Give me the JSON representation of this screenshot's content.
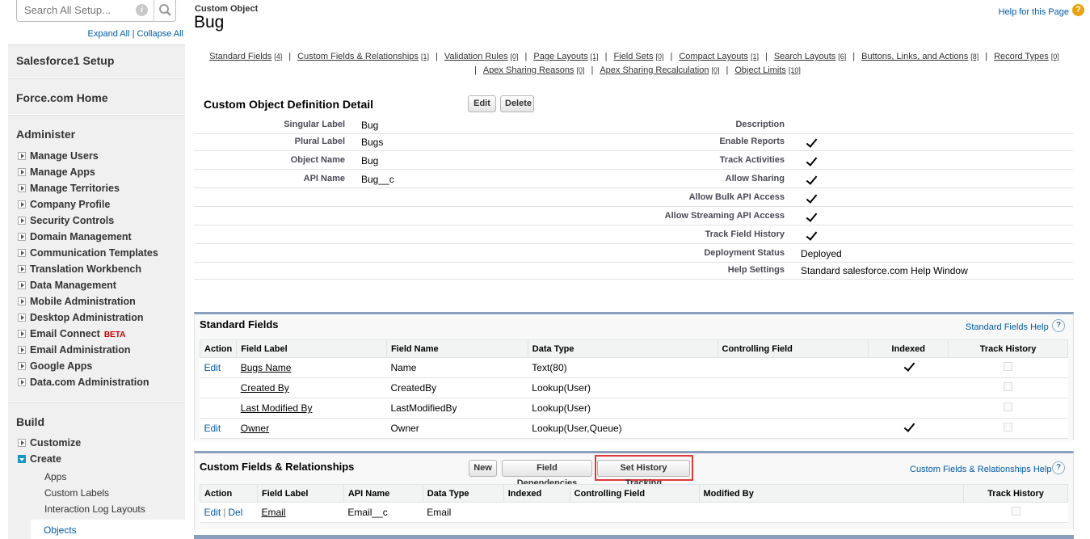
{
  "search": {
    "placeholder": "Search All Setup..."
  },
  "sidebar": {
    "expand_all": "Expand All",
    "separator": "|",
    "collapse_all": "Collapse All",
    "salesforce1_setup": "Salesforce1 Setup",
    "force_home": "Force.com Home",
    "administer": {
      "heading": "Administer",
      "items": [
        "Manage Users",
        "Manage Apps",
        "Manage Territories",
        "Company Profile",
        "Security Controls",
        "Domain Management",
        "Communication Templates",
        "Translation Workbench",
        "Data Management",
        "Mobile Administration",
        "Desktop Administration",
        "Email Connect",
        "Email Administration",
        "Google Apps",
        "Data.com Administration"
      ],
      "beta_label": "BETA"
    },
    "build": {
      "heading": "Build",
      "customize": "Customize",
      "create": "Create",
      "create_children": [
        "Apps",
        "Custom Labels",
        "Interaction Log Layouts",
        "Objects"
      ]
    }
  },
  "header": {
    "object_type": "Custom Object",
    "object_name": "Bug",
    "help_link": "Help for this Page"
  },
  "related_links": {
    "row1": [
      {
        "label": "Standard Fields",
        "count": "[4]"
      },
      {
        "label": "Custom Fields & Relationships",
        "count": "[1]"
      },
      {
        "label": "Validation Rules",
        "count": "[0]"
      },
      {
        "label": "Page Layouts",
        "count": "[1]"
      },
      {
        "label": "Field Sets",
        "count": "[0]"
      },
      {
        "label": "Compact Layouts",
        "count": "[1]"
      },
      {
        "label": "Search Layouts",
        "count": "[6]"
      },
      {
        "label": "Buttons, Links, and Actions",
        "count": "[8]"
      },
      {
        "label": "Record Types",
        "count": "[0]"
      }
    ],
    "row2": [
      {
        "label": "Apex Sharing Reasons",
        "count": "[0]"
      },
      {
        "label": "Apex Sharing Recalculation",
        "count": "[0]"
      },
      {
        "label": "Object Limits",
        "count": "[10]"
      }
    ]
  },
  "detail": {
    "title": "Custom Object Definition Detail",
    "edit": "Edit",
    "delete": "Delete",
    "left": [
      {
        "label": "Singular Label",
        "value": "Bug"
      },
      {
        "label": "Plural Label",
        "value": "Bugs"
      },
      {
        "label": "Object Name",
        "value": "Bug"
      },
      {
        "label": "API Name",
        "value": "Bug__c"
      }
    ],
    "right": [
      {
        "label": "Description",
        "value": ""
      },
      {
        "label": "Enable Reports",
        "checked": true
      },
      {
        "label": "Track Activities",
        "checked": true
      },
      {
        "label": "Allow Sharing",
        "checked": true
      },
      {
        "label": "Allow Bulk API Access",
        "checked": true
      },
      {
        "label": "Allow Streaming API Access",
        "checked": true
      },
      {
        "label": "Track Field History",
        "checked": true
      },
      {
        "label": "Deployment Status",
        "value": "Deployed"
      },
      {
        "label": "Help Settings",
        "value": "Standard salesforce.com Help Window"
      }
    ]
  },
  "standard_fields": {
    "title": "Standard Fields",
    "help": "Standard Fields Help",
    "columns": [
      "Action",
      "Field Label",
      "Field Name",
      "Data Type",
      "Controlling Field",
      "Indexed",
      "Track History"
    ],
    "rows": [
      {
        "action": "Edit",
        "label": "Bugs Name",
        "name": "Name",
        "type": "Text(80)",
        "indexed": true
      },
      {
        "action": "",
        "label": "Created By",
        "name": "CreatedBy",
        "type": "Lookup(User)",
        "indexed": false
      },
      {
        "action": "",
        "label": "Last Modified By",
        "name": "LastModifiedBy",
        "type": "Lookup(User)",
        "indexed": false
      },
      {
        "action": "Edit",
        "label": "Owner",
        "name": "Owner",
        "type": "Lookup(User,Queue)",
        "indexed": true
      }
    ]
  },
  "custom_fields": {
    "title": "Custom Fields & Relationships",
    "new": "New",
    "field_dependencies": "Field Dependencies",
    "set_history_tracking": "Set History Tracking",
    "help": "Custom Fields & Relationships Help",
    "columns": [
      "Action",
      "Field Label",
      "API Name",
      "Data Type",
      "Indexed",
      "Controlling Field",
      "Modified By",
      "Track History"
    ],
    "rows": [
      {
        "edit": "Edit",
        "sep": "|",
        "del": "Del",
        "label": "Email",
        "api": "Email__c",
        "type": "Email"
      }
    ]
  },
  "colors": {
    "link": "#015ba7",
    "highlight": "#e03a3a",
    "list_border": "#8a9ebe"
  }
}
